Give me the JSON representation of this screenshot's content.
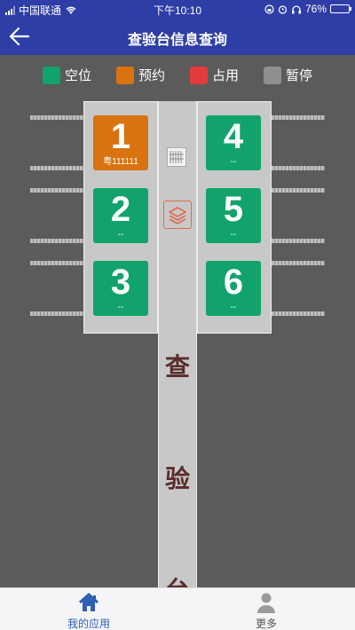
{
  "status_bar": {
    "carrier": "中国联通",
    "time": "下午10:10",
    "battery": "76%",
    "battery_level": 0.76
  },
  "header": {
    "title": "查验台信息查询"
  },
  "legend": [
    {
      "label": "空位",
      "color": "#11a36b"
    },
    {
      "label": "预约",
      "color": "#d9730f"
    },
    {
      "label": "占用",
      "color": "#e23b3b"
    },
    {
      "label": "暂停",
      "color": "#8f8f8f"
    }
  ],
  "slots": [
    {
      "number": "1",
      "plate": "粤111111",
      "status": "预约"
    },
    {
      "number": "2",
      "plate": "--",
      "status": "空位"
    },
    {
      "number": "3",
      "plate": "--",
      "status": "空位"
    },
    {
      "number": "4",
      "plate": "--",
      "status": "空位"
    },
    {
      "number": "5",
      "plate": "--",
      "status": "空位"
    },
    {
      "number": "6",
      "plate": "--",
      "status": "空位"
    }
  ],
  "lane_text": [
    "查",
    "验",
    "台"
  ],
  "tabbar": [
    {
      "label": "我的应用",
      "icon": "home-icon",
      "active": true
    },
    {
      "label": "更多",
      "icon": "person-icon",
      "active": false
    }
  ]
}
